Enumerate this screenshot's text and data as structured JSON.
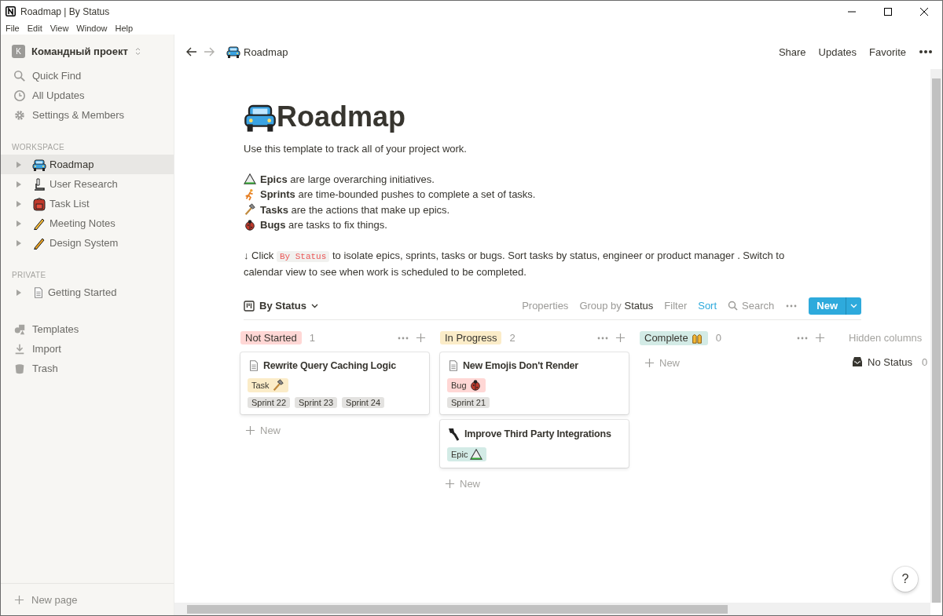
{
  "window": {
    "title": "Roadmap | By Status"
  },
  "menu": [
    "File",
    "Edit",
    "View",
    "Window",
    "Help"
  ],
  "sidebar": {
    "workspace": {
      "initial": "K",
      "name": "Командный проект"
    },
    "nav": [
      {
        "label": "Quick Find"
      },
      {
        "label": "All Updates"
      },
      {
        "label": "Settings & Members"
      }
    ],
    "sections": [
      {
        "heading": "WORKSPACE",
        "pages": [
          {
            "label": "Roadmap",
            "selected": true
          },
          {
            "label": "User Research",
            "selected": false
          },
          {
            "label": "Task List",
            "selected": false
          },
          {
            "label": "Meeting Notes",
            "selected": false
          },
          {
            "label": "Design System",
            "selected": false
          }
        ]
      },
      {
        "heading": "PRIVATE",
        "pages": [
          {
            "label": "Getting Started",
            "selected": false
          }
        ]
      }
    ],
    "tools": [
      {
        "label": "Templates"
      },
      {
        "label": "Import"
      },
      {
        "label": "Trash"
      }
    ],
    "new_page": "New page"
  },
  "topbar": {
    "breadcrumb": "Roadmap",
    "actions": [
      "Share",
      "Updates",
      "Favorite"
    ]
  },
  "page": {
    "title": "Roadmap",
    "intro": "Use this template to track all of your project work.",
    "legend": [
      "**Epics** are large overarching initiatives.",
      "**Sprints** are time-bounded pushes to complete a set of tasks.",
      "**Tasks** are the actions that make up epics.",
      "**Bugs** are tasks to fix things."
    ],
    "instruction": {
      "before": "↓ Click",
      "code": "By Status",
      "after": "to isolate epics, sprints, tasks or bugs. Sort tasks by status, engineer or product manager . Switch to calendar view to see when work is scheduled to be completed."
    }
  },
  "board": {
    "view": "By Status",
    "toolbar": [
      {
        "label": "Properties",
        "active": false
      },
      {
        "label": "Group by **Status**",
        "active": false
      },
      {
        "label": "Filter",
        "active": false
      },
      {
        "label": "Sort",
        "active": true
      }
    ],
    "search": "Search",
    "new_button": "New",
    "columns": [
      {
        "status": "Not Started",
        "color": "#ffd7d5",
        "count": "1",
        "add_label": "New",
        "cards": [
          {
            "title": "Rewrite Query Caching Logic",
            "kind": "page",
            "tags": [
              {
                "label": "Task",
                "kind": "task",
                "color": "#fbecc8"
              }
            ],
            "sprints": [
              "Sprint 22",
              "Sprint 23",
              "Sprint 24"
            ]
          }
        ]
      },
      {
        "status": "In Progress",
        "color": "#fbecc8",
        "count": "2",
        "add_label": "New",
        "cards": [
          {
            "title": "New Emojis Don't Render",
            "kind": "page",
            "tags": [
              {
                "label": "Bug",
                "kind": "bug",
                "color": "#ffd7d5"
              }
            ],
            "sprints": [
              "Sprint 21"
            ]
          },
          {
            "title": "Improve Third Party Integrations",
            "kind": "emoji",
            "tags": [
              {
                "label": "Epic",
                "kind": "epic",
                "color": "#d3ebe6"
              }
            ]
          }
        ]
      },
      {
        "status": "Complete",
        "kind": "celebrate",
        "color": "#d3ebe6",
        "count": "0",
        "add_label": "New"
      }
    ],
    "hidden": {
      "heading": "Hidden columns",
      "groups": [
        {
          "label": "No Status",
          "count": "0"
        }
      ]
    }
  },
  "help": "?"
}
